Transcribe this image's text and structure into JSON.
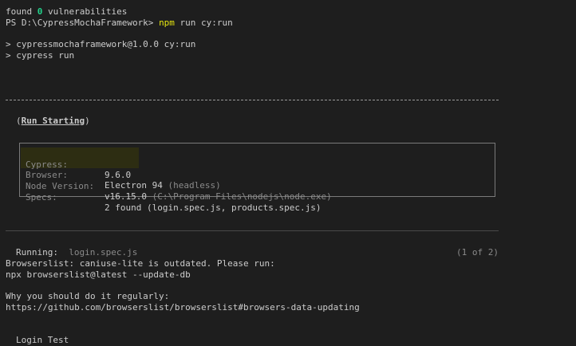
{
  "terminal": {
    "audit_prefix": "found ",
    "audit_count": "0",
    "audit_suffix": " vulnerabilities",
    "prompt": "PS D:\\CypressMochaFramework> ",
    "command": "npm",
    "command_args": " run cy:run",
    "script_line1": "> cypressmochaframework@1.0.0 cy:run",
    "script_line2": "> cypress run",
    "double_divider": "====================================================================================================",
    "run_starting_open": "(",
    "run_starting_label": "Run Starting",
    "run_starting_close": ")",
    "run_info": [
      {
        "key": "Cypress:",
        "value": "9.6.0",
        "extra": ""
      },
      {
        "key": "Browser:",
        "value": "Electron 94",
        "extra": " (headless)"
      },
      {
        "key": "Node Version:",
        "value": "v16.15.0",
        "extra": " (C:\\Program Files\\nodejs\\node.exe)"
      },
      {
        "key": "Specs:",
        "value": "2 found (login.spec.js, products.spec.js)",
        "extra": ""
      }
    ],
    "running_label": "Running:",
    "running_spec": "login.spec.js",
    "running_count": "(1 of 2)",
    "browserslist_line1": "Browserslist: caniuse-lite is outdated. Please run:",
    "browserslist_line2": "npx browserslist@latest --update-db",
    "why_line": "Why you should do it regularly:",
    "why_url": "https://github.com/browserslist/browserslist#browsers-data-updating",
    "suite_title": "Login Test"
  },
  "colors": {
    "background": "#1e1e1e",
    "text": "#cccccc",
    "green": "#23d18b",
    "yellow": "#e5e510",
    "grey": "#8a8a8a"
  }
}
